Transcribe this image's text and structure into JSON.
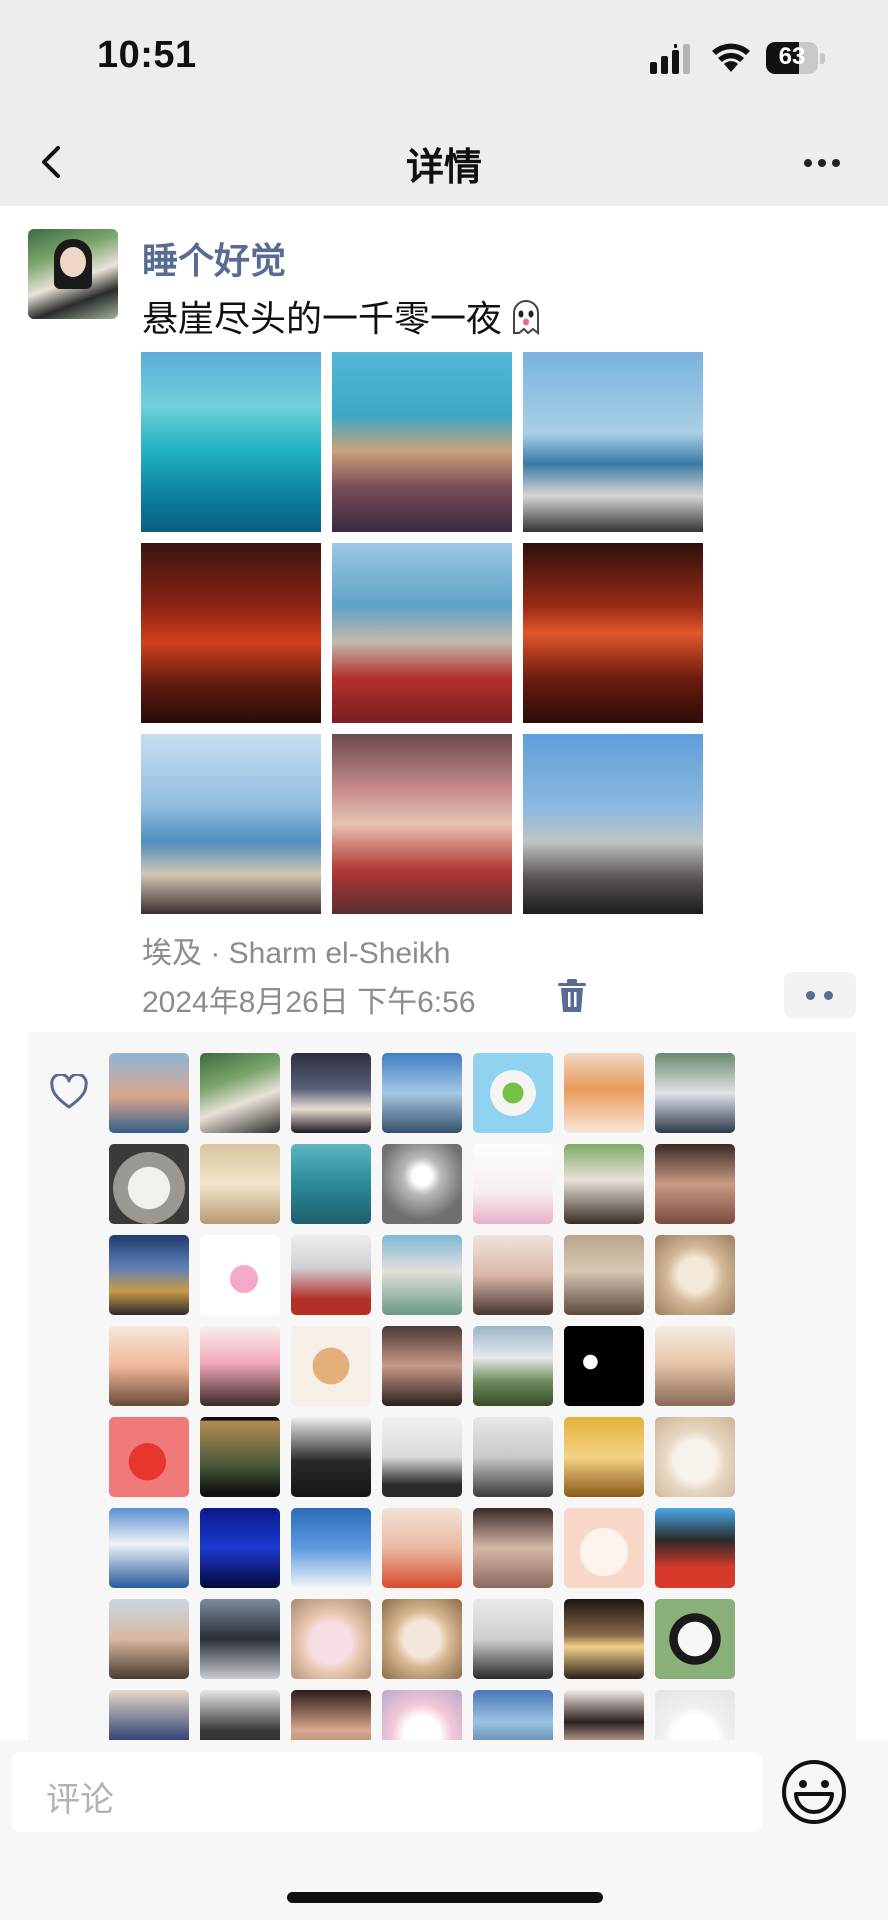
{
  "status_bar": {
    "time": "10:51",
    "battery": "63",
    "battery_level": 0.63
  },
  "nav": {
    "title": "详情",
    "back_icon": "chevron-left-icon",
    "more_icon": "more-icon"
  },
  "post": {
    "username": "睡个好觉",
    "text": "悬崖尽头的一千零一夜",
    "text_emoji": "ghost-emoji-icon",
    "photos": [
      {
        "name": "photo-turquoise-sea",
        "bg": "linear-gradient(180deg,#5aaed8 0%,#6fd0d8 30%,#1fb3c0 55%,#0d7fa0 80%,#0a5e82 100%)"
      },
      {
        "name": "photo-beach-crowd",
        "bg": "linear-gradient(180deg,#55b6d6 0%,#3aa9c5 35%,#c9a27a 55%,#7a4c59 75%,#3b2a40 100%)"
      },
      {
        "name": "photo-woman-balcony",
        "bg": "linear-gradient(180deg,#79b4de 0%,#a9cfe6 45%,#3a79a6 62%,#d7d5d1 80%,#333 100%)"
      },
      {
        "name": "photo-red-lanterns",
        "bg": "linear-gradient(180deg,#3a1410 0%,#8a2414 35%,#d0401e 55%,#5a1a10 80%,#2a0c08 100%)"
      },
      {
        "name": "photo-woman-cushions",
        "bg": "linear-gradient(180deg,#9ec7e2 0%,#5fa1c7 35%,#c3b9ac 55%,#b2302e 75%,#7a1e20 100%)"
      },
      {
        "name": "photo-lantern-shop",
        "bg": "linear-gradient(180deg,#2c100c 0%,#9a2a16 35%,#e2562a 50%,#6d1c10 75%,#2a0c08 100%)"
      },
      {
        "name": "photo-hanging-lamps",
        "bg": "linear-gradient(180deg,#c8def0 0%,#8fbde0 40%,#4f8fbd 60%,#d3c6b4 78%,#3b2f2d 100%)"
      },
      {
        "name": "photo-party-crowd",
        "bg": "linear-gradient(180deg,#6b4a4d 0%,#c68a8a 30%,#e6c2b4 50%,#b33a36 75%,#5a2d30 100%)"
      },
      {
        "name": "photo-woman-portrait",
        "bg": "linear-gradient(180deg,#5f9fd9 0%,#8ab8e0 40%,#bfc4c4 60%,#5a5452 80%,#1d1d1d 100%)"
      }
    ],
    "location": "埃及 · Sharm el-Sheikh",
    "timestamp": "2024年8月26日 下午6:56",
    "delete_icon": "trash-icon",
    "action_icon": "two-dots-icon"
  },
  "likes": {
    "icon": "heart-outline-icon",
    "avatars": [
      {
        "name": "sunset-beach",
        "bg": "linear-gradient(180deg,#8fb6d4,#d9a58a 55%,#2f5f8a)"
      },
      {
        "name": "girl-green",
        "bg": "linear-gradient(160deg,#3d6b3f,#7aa56d 35%,#e9e2d8 60%,#2c2c2c)"
      },
      {
        "name": "anime-dark-hair",
        "bg": "linear-gradient(180deg,#2b2e3d,#5a6078 45%,#e9ddd4 70%,#1c1c24)"
      },
      {
        "name": "silhouette-hill",
        "bg": "linear-gradient(180deg,#3f7ec4,#a6c7e4 50%,#35506b)"
      },
      {
        "name": "cartoon-powerpuff",
        "bg": "radial-gradient(circle at 50% 50%,#76c043 0 18%,#f4f4f4 19% 40%,#8fd3f0 41%)"
      },
      {
        "name": "anime-girl-orange",
        "bg": "linear-gradient(180deg,#f0d8c4,#e89a5a 45%,#f7e7da)"
      },
      {
        "name": "girl-lake",
        "bg": "linear-gradient(180deg,#6b8a6d,#dfe3e8 50%,#2d3a4a)"
      },
      {
        "name": "cat-face",
        "bg": "radial-gradient(circle at 50% 55%,#f3f0ec 0 35%,#9b9894 36% 60%,#3b3a38 61%)"
      },
      {
        "name": "girl-plush-hat",
        "bg": "linear-gradient(180deg,#d9c6a0,#f2e5cc 50%,#b59b70)"
      },
      {
        "name": "underwater-swimmer",
        "bg": "linear-gradient(180deg,#5db5c0,#2a8a99 50%,#1e5e6d)"
      },
      {
        "name": "moon-dog",
        "bg": "radial-gradient(circle at 50% 40%,#ffffff 0 15%,#b9b9b9 30%,#6f6f6f 70%)"
      },
      {
        "name": "pink-guitar-doll",
        "bg": "linear-gradient(180deg,#fdfdfd,#f7eef2 60%,#e7b2c9)"
      },
      {
        "name": "girl-garden",
        "bg": "linear-gradient(180deg,#7fa968,#e8e2d8 45%,#3a2d28)"
      },
      {
        "name": "girl-grad-cap",
        "bg": "linear-gradient(180deg,#3a2a24,#c99a84 50%,#7a4c40)"
      },
      {
        "name": "palace-sunset",
        "bg": "linear-gradient(180deg,#1f3a6e,#5d7fb6 40%,#c89a4a 70%,#2a2a2a)"
      },
      {
        "name": "pink-rabbit-sparkles",
        "bg": "radial-gradient(circle at 55% 55%,#f5a9c8 0 22%,#ffffff 23%)"
      },
      {
        "name": "anime-white-hair",
        "bg": "linear-gradient(180deg,#ededed,#d2d2d6 40%,#b2302a 80%)"
      },
      {
        "name": "girl-flowers",
        "bg": "linear-gradient(180deg,#7fb7d8,#e3e0da 45%,#6a9a84)"
      },
      {
        "name": "girl-lying",
        "bg": "linear-gradient(180deg,#f1e4dc,#d9b8a8 50%,#4a3530)"
      },
      {
        "name": "boy-with-cat",
        "bg": "linear-gradient(180deg,#b9a48c,#d7c8b5 45%,#5a4a3c)"
      },
      {
        "name": "cat-closeup",
        "bg": "radial-gradient(circle at 50% 50%,#f4e8d8 0 30%,#d2b898 50%,#9c7d5c)"
      },
      {
        "name": "cartoon-couple",
        "bg": "linear-gradient(180deg,#f6e7dc,#f2b89a 50%,#6a4a3a)"
      },
      {
        "name": "anime-pink-hair",
        "bg": "linear-gradient(180deg,#f7f0ec,#f3a9bd 45%,#3b2a2a)"
      },
      {
        "name": "plush-lion",
        "bg": "radial-gradient(circle at 50% 50%,#e3b07a 0 32%,#f5efe8 33%)"
      },
      {
        "name": "laughing-boy",
        "bg": "linear-gradient(180deg,#4a3a34,#c9988a 50%,#2a201c)"
      },
      {
        "name": "cliff-sea",
        "bg": "linear-gradient(180deg,#9cb7c8,#e6e8ea 40%,#6a8a5a 70%,#3a4a2a)"
      },
      {
        "name": "black-eyes",
        "bg": "radial-gradient(circle at 33% 45%,#ffffff 0 10%,#000 11%)"
      },
      {
        "name": "girl-princess",
        "bg": "linear-gradient(180deg,#f4ede6,#e9c6a8 45%,#8a6a58)"
      },
      {
        "name": "red-cherry",
        "bg": "radial-gradient(circle at 48% 56%,#e8362e 0 30%,#f07a7a 31%)"
      },
      {
        "name": "dark-silhouette",
        "bg": "linear-gradient(180deg,#0d0d0d 0 4%,#b48a54 5%,#4a5a3a 60%,#0d0d0d 96%)"
      },
      {
        "name": "girl-dark-hair",
        "bg": "linear-gradient(180deg,#f0f0f2,#2a2a2e 55%,#151518)"
      },
      {
        "name": "penguin-sticker",
        "bg": "linear-gradient(180deg,#f2f2f2,#dadada 50%,#2a2a2a 85%)"
      },
      {
        "name": "black-cat-branches",
        "bg": "linear-gradient(180deg,#e8e8e8,#c9c9c9 50%,#3a3a3a)"
      },
      {
        "name": "fortune-cat",
        "bg": "linear-gradient(180deg,#e4b23a,#f4d184 50%,#8a5a1a)"
      },
      {
        "name": "puppies",
        "bg": "radial-gradient(circle at 50% 55%,#f7f2ec 0 35%,#e8d8c2 50%,#cbb395)"
      },
      {
        "name": "cloud-sticker-sea",
        "bg": "linear-gradient(180deg,#5a8fd0,#eef2f6 45%,#2a5a9a)"
      },
      {
        "name": "deep-blue-silhouette",
        "bg": "linear-gradient(180deg,#0a1a8a,#1d3ad0 50%,#050a3a)"
      },
      {
        "name": "blue-sky-cloud",
        "bg": "linear-gradient(180deg,#2a6aba,#5e9ae0 50%,#f2f4f8)"
      },
      {
        "name": "baby-drinking",
        "bg": "linear-gradient(180deg,#f2e2d4,#e9b9a3 50%,#d84a2e)"
      },
      {
        "name": "girl-closeup",
        "bg": "linear-gradient(180deg,#3a2a28,#d6b8a8 50%,#8a6a60)"
      },
      {
        "name": "rabbit-drawing",
        "bg": "radial-gradient(circle at 50% 55%,#fff3ec 0 40%,#f8d6c8 41%)"
      },
      {
        "name": "anime-boy-red",
        "bg": "linear-gradient(180deg,#4aa8e8,#2a2a2a 40%,#d83a2a 75%)"
      },
      {
        "name": "girl-beach",
        "bg": "linear-gradient(180deg,#c9d8e0,#d8b8a0 50%,#4a3a30)"
      },
      {
        "name": "penguin-rocks",
        "bg": "linear-gradient(180deg,#7a8a9a,#2a2e36 50%,#c8ccd0)"
      },
      {
        "name": "pink-bear-plush",
        "bg": "radial-gradient(circle at 50% 55%,#f7dde4 0 35%,#e8c8b0 50%,#a88a70)"
      },
      {
        "name": "cat-glasses",
        "bg": "radial-gradient(circle at 50% 50%,#f4e6da 0 32%,#d8b890 50%,#8a6a4a)"
      },
      {
        "name": "girl-snow",
        "bg": "linear-gradient(180deg,#e8e8ea,#cfcfd2 50%,#2a2a2a)"
      },
      {
        "name": "girl-night-light",
        "bg": "linear-gradient(180deg,#1a1410,#8a6a4a 45%,#f2d08a 60%,#2a2018)"
      },
      {
        "name": "panda",
        "bg": "radial-gradient(circle at 50% 50%,#f6f6f6 0 30%,#1a1a1a 31% 45%,#8ab07a 46%)"
      },
      {
        "name": "boy-blue-hoodie",
        "bg": "linear-gradient(180deg,#e8d8c8,#3a4a7a 60%,#1a1a2a)"
      },
      {
        "name": "boy-dark-room",
        "bg": "linear-gradient(180deg,#e8e8e8,#3a3a3a 50%,#1a1a1a)"
      },
      {
        "name": "woman-smile",
        "bg": "linear-gradient(180deg,#2a1a18,#d8a890 50%,#8a5a48)"
      },
      {
        "name": "white-kitten",
        "bg": "radial-gradient(circle at 50% 55%,#ffffff 0 30%,#f2c8d8 50%,#b9a8c8)"
      },
      {
        "name": "lake-mountain",
        "bg": "linear-gradient(180deg,#4a78b8,#9ac2e2 40%,#2a4a6a)"
      },
      {
        "name": "girl-bangs",
        "bg": "linear-gradient(180deg,#f4ece6,#2a2020 40%,#d8b8a8 70%)"
      },
      {
        "name": "smiling-snowball",
        "bg": "radial-gradient(circle at 50% 60%,#ffffff 0 35%,#f0f0f0 50%,#e4e4e4)"
      }
    ]
  },
  "comment_bar": {
    "placeholder": "评论",
    "emoji_icon": "smiley-icon"
  }
}
